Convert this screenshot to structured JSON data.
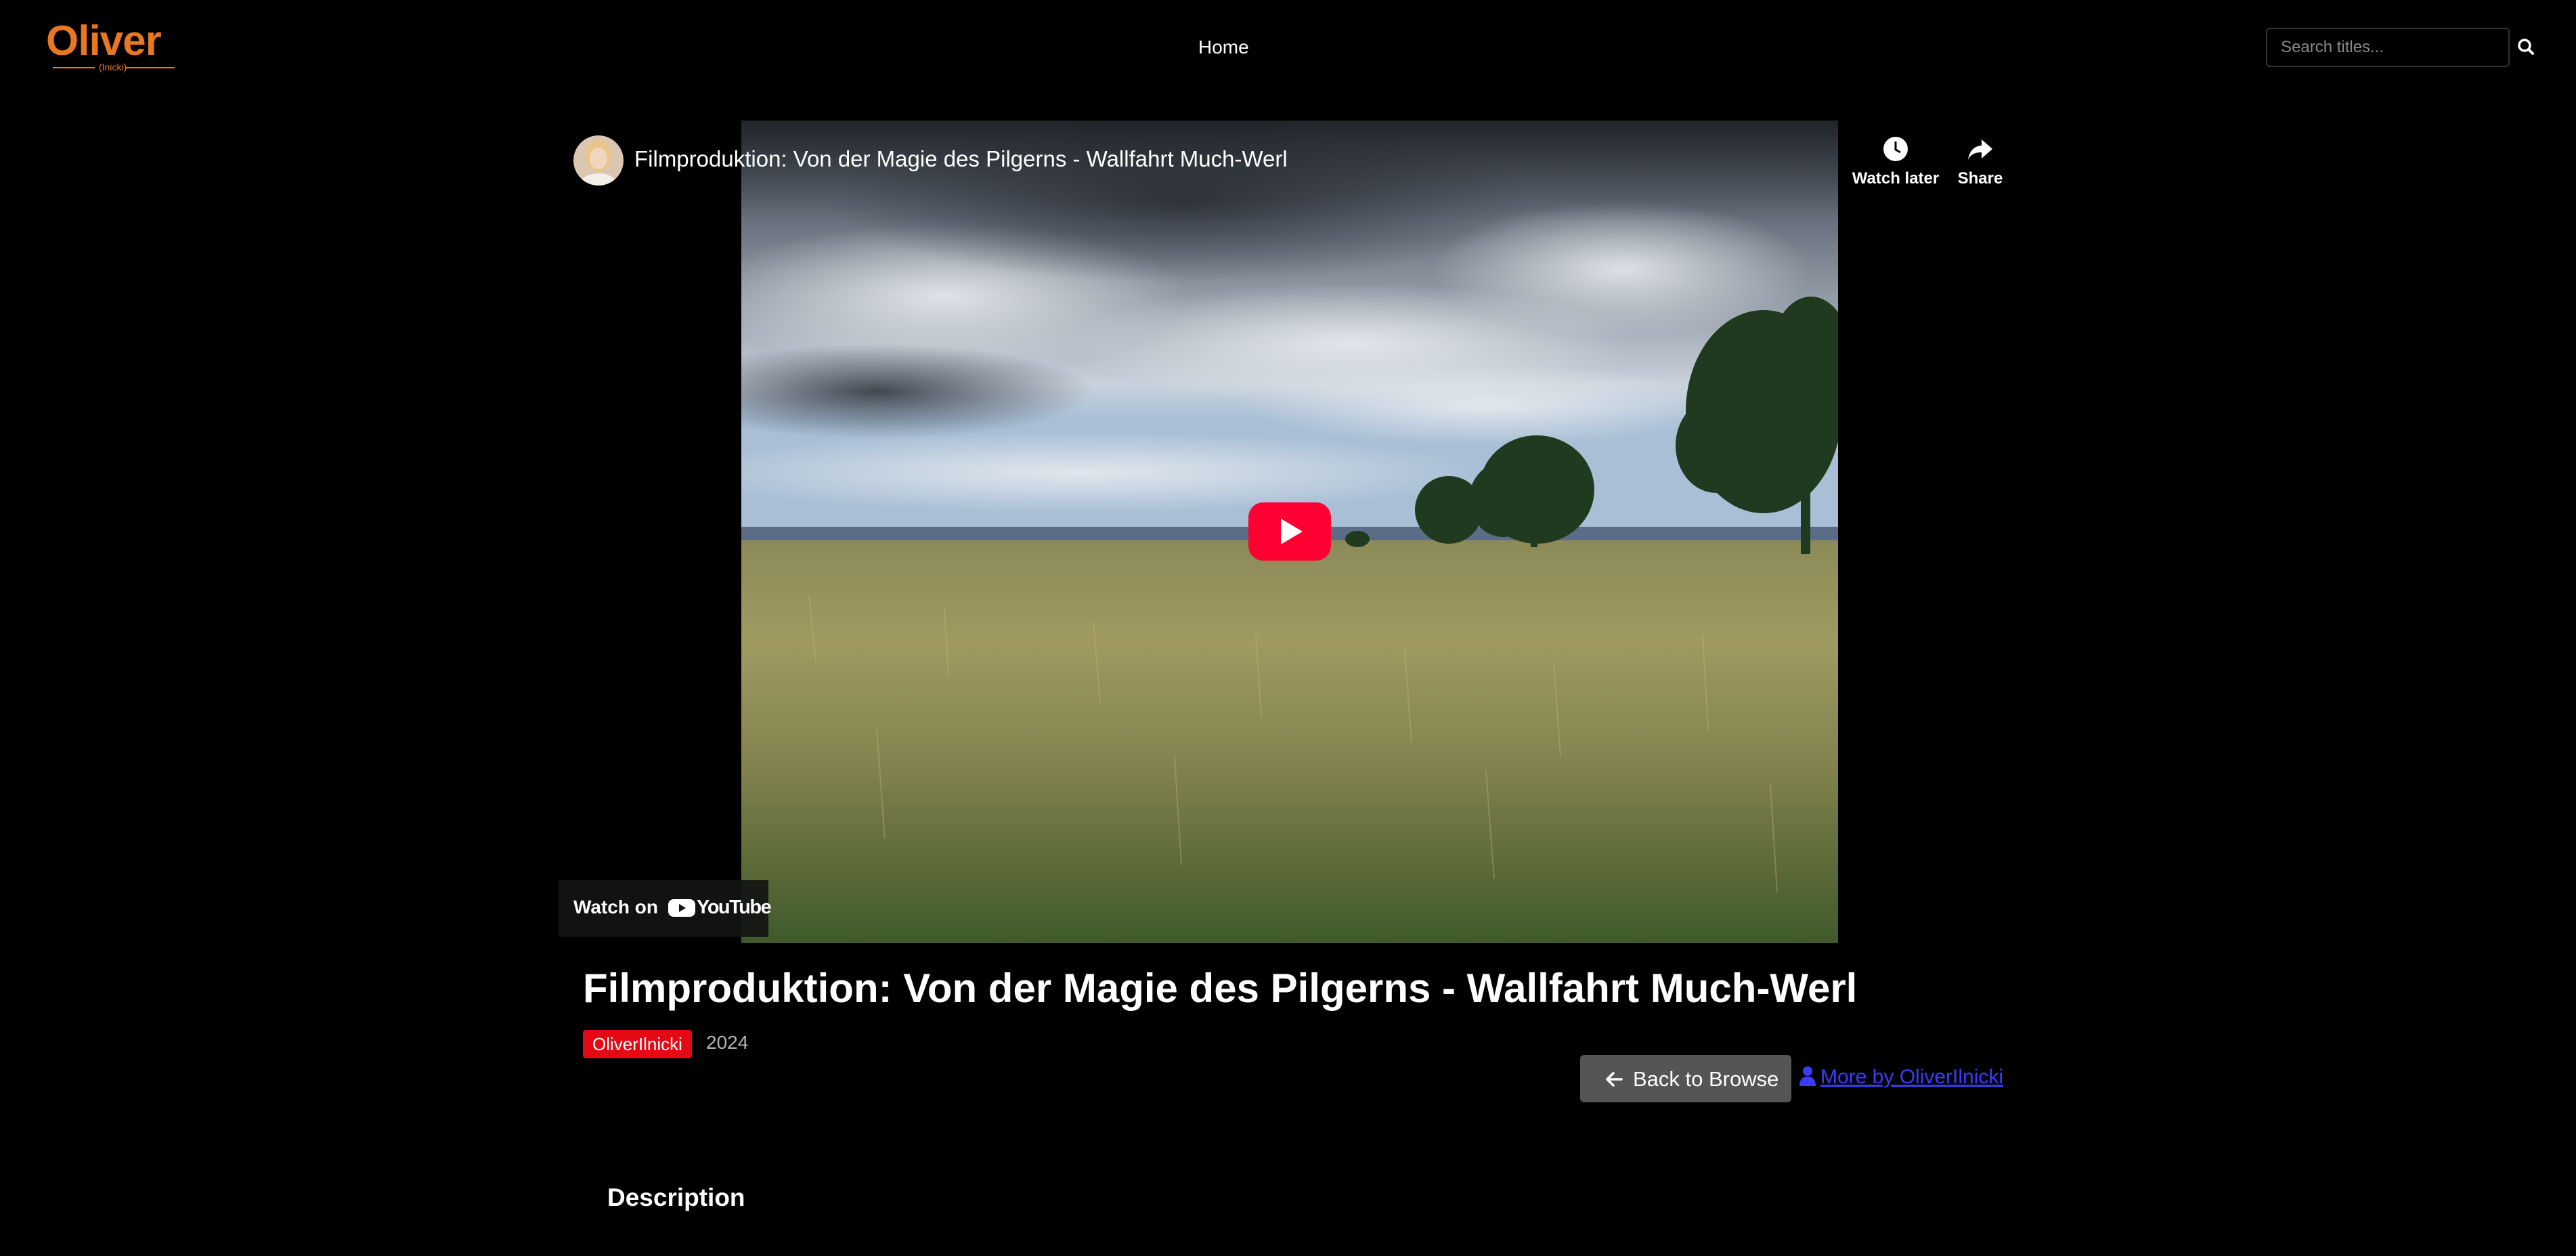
{
  "brand": {
    "logo_text": "Oliver",
    "logo_subtext": "(Inicki)",
    "accent_color": "#e87722"
  },
  "nav": {
    "home_label": "Home"
  },
  "search": {
    "placeholder": "Search titles...",
    "value": "",
    "icon": "search-icon"
  },
  "player": {
    "video_title": "Filmproduktion: Von der Magie des Pilgerns - Wallfahrt Much-Werl",
    "watch_later_label": "Watch later",
    "share_label": "Share",
    "watch_on_label": "Watch on",
    "youtube_wordmark": "YouTube",
    "play_button_color": "#ff0033"
  },
  "details": {
    "title": "Filmproduktion: Von der Magie des Pilgerns - Wallfahrt Much-Werl",
    "author": "OliverIlnicki",
    "year": "2024",
    "badge_color": "#e50914",
    "back_label": "Back to Browse",
    "more_by_label": "More by OliverIlnicki",
    "description_heading": "Description"
  }
}
